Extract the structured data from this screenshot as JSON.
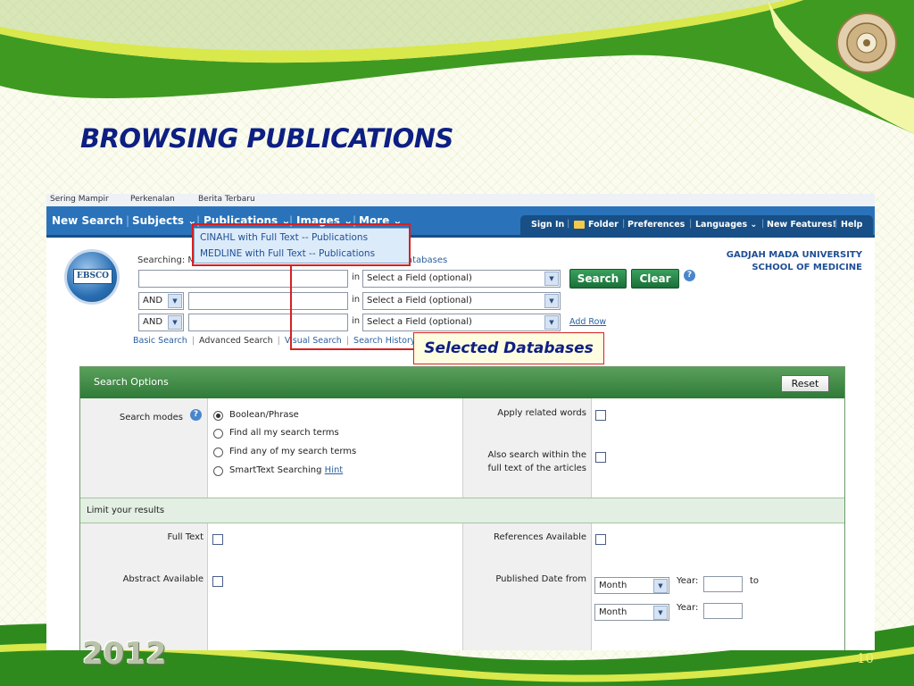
{
  "slide": {
    "title": "BROWSING PUBLICATIONS",
    "year": "2012",
    "page_number": "10",
    "colors": {
      "title": "#0d1f82",
      "green_band": "#2f8a1e",
      "accent_yellow": "#d9e84a"
    }
  },
  "browser": {
    "bookmarks": [
      "Sering Mampir",
      "Perkenalan",
      "Berita Terbaru"
    ]
  },
  "topnav": {
    "items": [
      "New Search",
      "Subjects ⌄",
      "Publications ⌄",
      "Images ⌄",
      "More ⌄"
    ],
    "util": [
      "Sign In",
      "Folder",
      "Preferences",
      "Languages ⌄",
      "New Features!",
      "Help"
    ]
  },
  "publications_menu": {
    "options": [
      "CINAHL with Full Text -- Publications",
      "MEDLINE with Full Text -- Publications"
    ]
  },
  "search": {
    "searching_label": "Searching: M",
    "databases_link": "atabases",
    "in_label": "in",
    "field_placeholder": "Select a Field (optional)",
    "bool_value": "AND",
    "search_button": "Search",
    "clear_button": "Clear",
    "add_row": "Add Row",
    "links": [
      "Basic Search",
      "Advanced Search",
      "Visual Search",
      "Search History"
    ],
    "logo_text": "EBSCO"
  },
  "institution": {
    "line1": "GADJAH MADA UNIVERSITY",
    "line2": "SCHOOL OF MEDICINE"
  },
  "callout": {
    "text": "Selected Databases"
  },
  "options_panel": {
    "header": "Search Options",
    "reset": "Reset",
    "search_modes_label": "Search modes",
    "modes": [
      "Boolean/Phrase",
      "Find all my search terms",
      "Find any of my search terms",
      "SmartText Searching"
    ],
    "hint": "Hint",
    "selected_mode": "Boolean/Phrase",
    "apply_related": "Apply related words",
    "also_search_line1": "Also search within the",
    "also_search_line2": "full text of the articles",
    "limit_header": "Limit your results",
    "full_text": "Full Text",
    "abstract_available": "Abstract Available",
    "references_available": "References Available",
    "published_date_from": "Published Date from",
    "month": "Month",
    "year_label": "Year:",
    "to_label": "to"
  }
}
